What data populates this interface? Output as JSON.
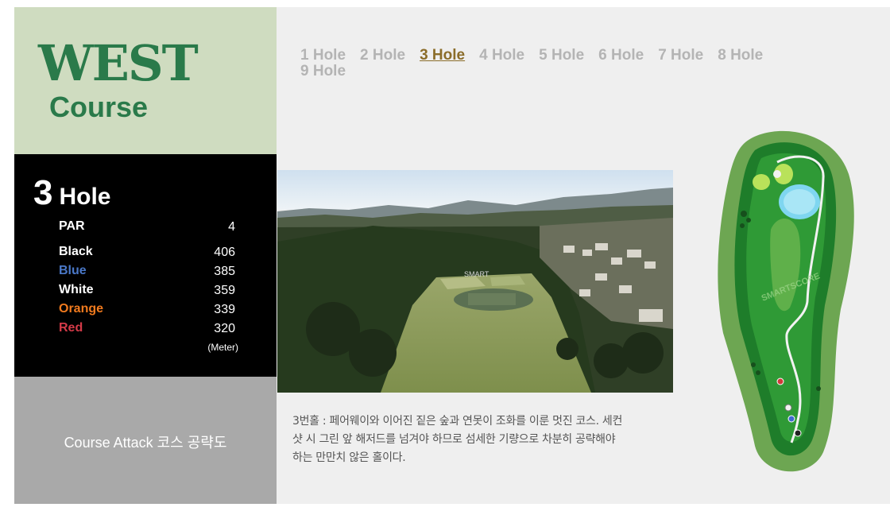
{
  "logo": {
    "line1": "WEST",
    "line2": "Course"
  },
  "hole": {
    "number": "3",
    "word": "Hole",
    "rows": [
      {
        "label": "PAR",
        "value": "4",
        "color": "#ffffff"
      },
      {
        "label": "Black",
        "value": "406",
        "color": "#ffffff"
      },
      {
        "label": "Blue",
        "value": "385",
        "color": "#4a78c8"
      },
      {
        "label": "White",
        "value": "359",
        "color": "#ffffff"
      },
      {
        "label": "Orange",
        "value": "339",
        "color": "#f07a1e"
      },
      {
        "label": "Red",
        "value": "320",
        "color": "#d43a48"
      }
    ],
    "unit": "(Meter)"
  },
  "attack": {
    "label": "Course Attack 코스 공략도"
  },
  "tabs": [
    {
      "label": "1 Hole",
      "active": false
    },
    {
      "label": "2 Hole",
      "active": false
    },
    {
      "label": "3 Hole",
      "active": true
    },
    {
      "label": "4 Hole",
      "active": false
    },
    {
      "label": "5 Hole",
      "active": false
    },
    {
      "label": "6 Hole",
      "active": false
    },
    {
      "label": "7 Hole",
      "active": false
    },
    {
      "label": "8 Hole",
      "active": false
    },
    {
      "label": "9 Hole",
      "active": false
    }
  ],
  "photo": {
    "watermark": "SMART"
  },
  "description": "3번홀 : 페어웨이와 이어진 짙은 숲과 연못이 조화를 이룬 멋진 코스. 세컨샷 시 그린 앞 해저드를 넘겨야 하므로 섬세한 기량으로 차분히 공략해야 하는 만만치 않은 홀이다.",
  "map": {
    "watermark": "SMARTSCORE"
  },
  "colors": {
    "brand_green": "#2a7a4a",
    "active_tab": "#8b6d2a",
    "inactive_tab": "#b4b4b4"
  }
}
